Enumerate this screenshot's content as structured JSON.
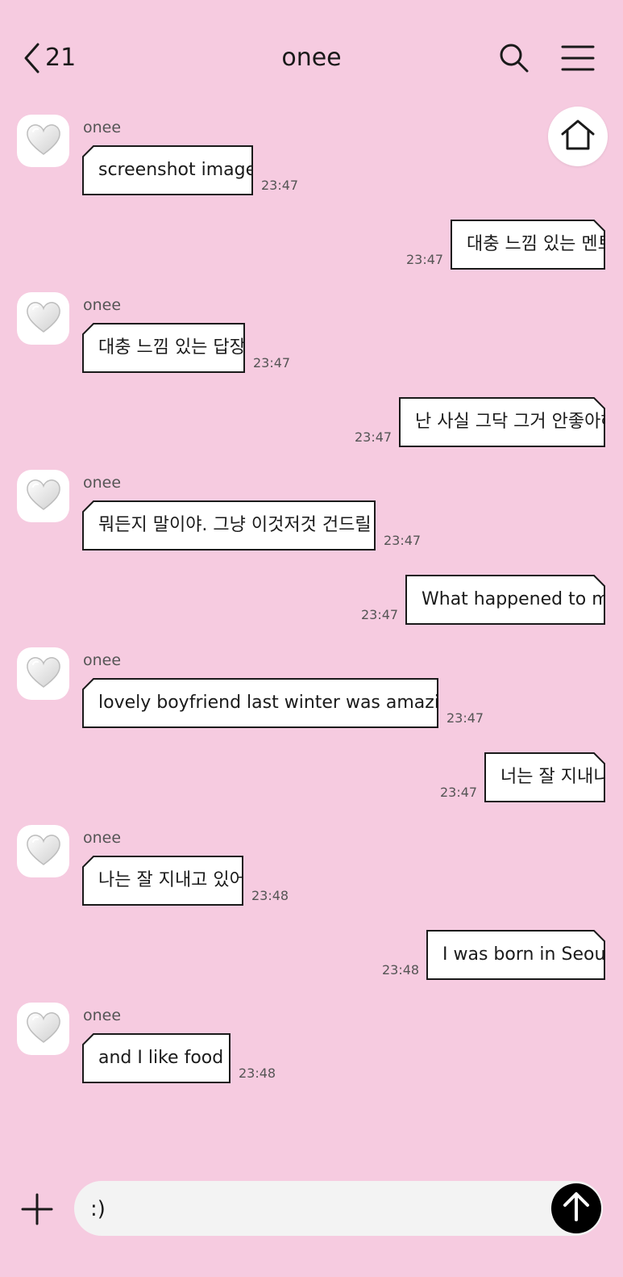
{
  "header": {
    "back_count": "21",
    "title": "onee"
  },
  "messages": [
    {
      "direction": "in",
      "sender": "onee",
      "text": "screenshot image",
      "time": "23:47"
    },
    {
      "direction": "out",
      "text": "대충 느낌 있는 멘트",
      "time": "23:47"
    },
    {
      "direction": "in",
      "sender": "onee",
      "text": "대충 느낌 있는 답장",
      "time": "23:47"
    },
    {
      "direction": "out",
      "text": "난 사실 그닥 그거 안좋아해",
      "time": "23:47"
    },
    {
      "direction": "in",
      "sender": "onee",
      "text": "뭐든지 말이야. 그냥 이것저것 건드릴 뿐.",
      "time": "23:47"
    },
    {
      "direction": "out",
      "text": "What happened to my",
      "time": "23:47"
    },
    {
      "direction": "in",
      "sender": "onee",
      "text": "lovely boyfriend last winter was amazing",
      "time": "23:47"
    },
    {
      "direction": "out",
      "text": "너는 잘 지내니",
      "time": "23:47"
    },
    {
      "direction": "in",
      "sender": "onee",
      "text": "나는 잘 지내고 있어",
      "time": "23:48"
    },
    {
      "direction": "out",
      "text": "I was born in Seoul",
      "time": "23:48"
    },
    {
      "direction": "in",
      "sender": "onee",
      "text": "and I like food",
      "time": "23:48"
    }
  ],
  "composer": {
    "value": ":)"
  },
  "icons": {
    "back": "chevron-left-icon",
    "search": "search-icon",
    "menu": "hamburger-menu-icon",
    "home": "home-icon",
    "avatar": "heart-icon",
    "plus": "plus-icon",
    "send": "arrow-up-icon"
  },
  "colors": {
    "background": "#f6cbe0",
    "bubble": "#ffffff",
    "bubble_border": "#1a1a1a",
    "input_bg": "#f3f3f3",
    "send_bg": "#000000"
  }
}
